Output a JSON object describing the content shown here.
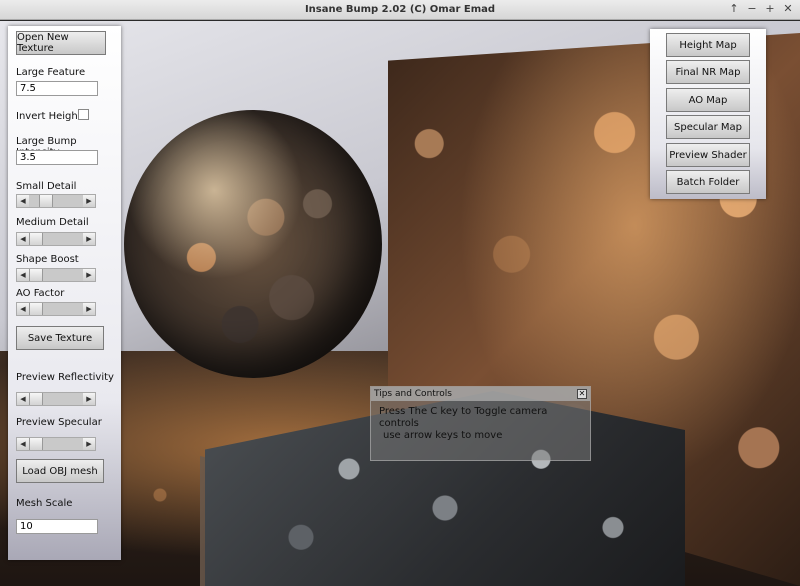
{
  "window": {
    "title": "Insane Bump 2.02 (C) Omar Emad"
  },
  "titlebar_controls": [
    "↑",
    "−",
    "+",
    "✕"
  ],
  "left_panel": {
    "open_texture_label": "Open New Texture",
    "large_feature_label": "Large Feature",
    "large_feature_value": "7.5",
    "invert_height_label": "Invert Height",
    "large_bump_intensity_label": "Large Bump Intensity",
    "large_bump_intensity_value": "3.5",
    "small_detail_label": "Small Detail",
    "medium_detail_label": "Medium Detail",
    "shape_boost_label": "Shape Boost",
    "ao_factor_label": "AO Factor",
    "save_texture_label": "Save Texture",
    "preview_reflectivity_label": "Preview Reflectivity",
    "preview_specular_label": "Preview Specular",
    "load_obj_label": "Load OBJ mesh",
    "mesh_scale_label": "Mesh Scale",
    "mesh_scale_value": "10"
  },
  "right_panel": {
    "height_map_label": "Height Map",
    "final_nr_map_label": "Final NR Map",
    "ao_map_label": "AO Map",
    "specular_map_label": "Specular Map",
    "preview_shader_label": "Preview Shader",
    "batch_folder_label": "Batch Folder"
  },
  "tips": {
    "title": "Tips and Controls",
    "close": "✕",
    "line1": "Press The C key to Toggle camera controls",
    "line2": "use arrow keys to move"
  },
  "sliders": {
    "small_detail": 0.25,
    "medium_detail": 0.0,
    "shape_boost": 0.0,
    "ao_factor": 0.0,
    "preview_reflectivity": 0.0,
    "preview_specular": 0.0
  },
  "icons": {
    "arrow_left": "◀",
    "arrow_right": "▶"
  }
}
